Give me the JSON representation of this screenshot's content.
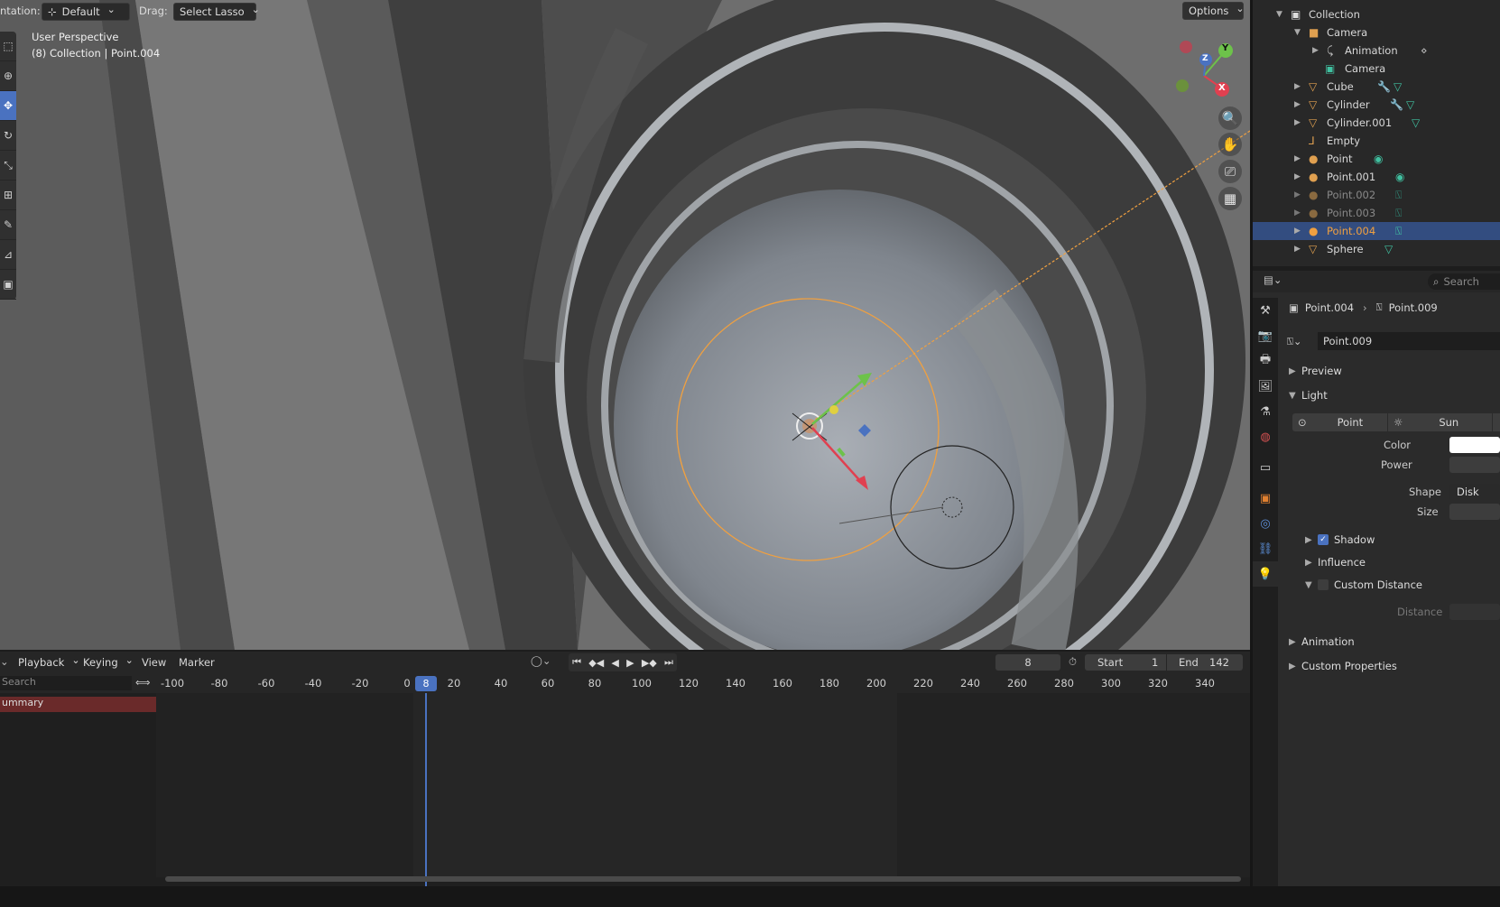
{
  "viewport": {
    "orientation_label": "ntation:",
    "orientation_value": "Default",
    "drag_label": "Drag:",
    "drag_value": "Select Lasso",
    "options_label": "Options",
    "perspective": "User Perspective",
    "context": "(8) Collection | Point.004",
    "gizmo": {
      "y": "Y",
      "z": "Z",
      "x": "X"
    }
  },
  "outliner": {
    "root": "Collection",
    "rows": [
      {
        "label": "Camera",
        "icon": "camera-object-icon"
      },
      {
        "label": "Animation",
        "icon": "action-icon"
      },
      {
        "label": "Camera",
        "icon": "camera-data-icon"
      },
      {
        "label": "Cube",
        "icon": "mesh-icon"
      },
      {
        "label": "Cylinder",
        "icon": "mesh-icon"
      },
      {
        "label": "Cylinder.001",
        "icon": "mesh-icon"
      },
      {
        "label": "Empty",
        "icon": "empty-icon"
      },
      {
        "label": "Point",
        "icon": "light-icon"
      },
      {
        "label": "Point.001",
        "icon": "light-icon"
      },
      {
        "label": "Point.002",
        "icon": "light-icon"
      },
      {
        "label": "Point.003",
        "icon": "light-icon"
      },
      {
        "label": "Point.004",
        "icon": "light-icon"
      },
      {
        "label": "Sphere",
        "icon": "mesh-icon"
      }
    ]
  },
  "properties": {
    "search_placeholder": "Search",
    "breadcrumb_object": "Point.004",
    "breadcrumb_data": "Point.009",
    "datablock_name": "Point.009",
    "sections": {
      "preview": "Preview",
      "light": "Light",
      "shadow": "Shadow",
      "influence": "Influence",
      "custom_distance": "Custom Distance",
      "animation": "Animation",
      "custom_properties": "Custom Properties"
    },
    "light_types": [
      "Point",
      "Sun"
    ],
    "fields": {
      "color": "Color",
      "power": "Power",
      "shape": "Shape",
      "shape_value": "Disk",
      "size": "Size",
      "distance": "Distance"
    },
    "shadow_checked": true,
    "custom_distance_checked": false
  },
  "timeline": {
    "menus": [
      "Playback",
      "Keying",
      "View",
      "Marker"
    ],
    "current_frame": "8",
    "start_label": "Start",
    "start_value": "1",
    "end_label": "End",
    "end_value": "142",
    "search_placeholder": "Search",
    "summary": "ummary",
    "ticks": [
      "-100",
      "-80",
      "-60",
      "-40",
      "-20",
      "0",
      "20",
      "40",
      "60",
      "80",
      "100",
      "120",
      "140",
      "160",
      "180",
      "200",
      "220",
      "240",
      "260",
      "280",
      "300",
      "320",
      "340"
    ]
  },
  "colors": {
    "accent": "#4a72c0",
    "selection": "#334d80",
    "light_outline": "#f0a040",
    "mesh_icon": "#e0a050",
    "data_icon": "#40c0a0"
  }
}
